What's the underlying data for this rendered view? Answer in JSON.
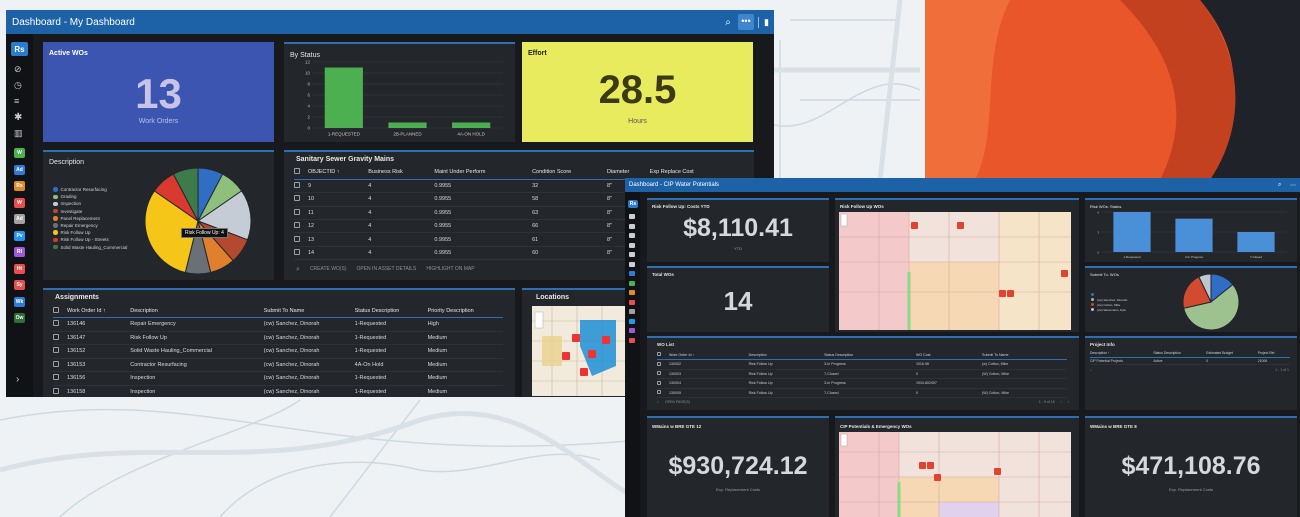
{
  "main_window": {
    "title": "Dashboard - My Dashboard",
    "sidebar_logo": "Rs",
    "sidebar_badges": [
      {
        "text": "W",
        "color": "#4caf50"
      },
      {
        "text": "Ad",
        "color": "#2f7bd8"
      },
      {
        "text": "Rs",
        "color": "#e08b2a"
      },
      {
        "text": "W",
        "color": "#e84e4e"
      },
      {
        "text": "Ad",
        "color": "#a0a0a0"
      },
      {
        "text": "Pv",
        "color": "#2196f3"
      },
      {
        "text": "Rl",
        "color": "#9c5ad7"
      },
      {
        "text": "Ht",
        "color": "#e84e4e"
      },
      {
        "text": "Sy",
        "color": "#e84e4e"
      },
      {
        "text": "Wk",
        "color": "#2f7bd8"
      },
      {
        "text": "Ow",
        "color": "#2f6f38"
      }
    ],
    "active_wos": {
      "title": "Active WOs",
      "value": "13",
      "label": "Work Orders"
    },
    "by_status": {
      "title": "By Status"
    },
    "effort": {
      "title": "Effort",
      "value": "28.5",
      "label": "Hours"
    },
    "description": {
      "title": "Description",
      "legend": [
        "Contractor Resurfacing",
        "Grading",
        "Inspection",
        "Investigate",
        "Panel Replacement",
        "Repair Emergency",
        "Risk Follow Up",
        "Risk Follow Up - Streets",
        "Solid Waste Hauling_Commercial"
      ],
      "tooltip": "Risk Follow Up: 4"
    },
    "sewer": {
      "title": "Sanitary Sewer Gravity Mains",
      "columns": [
        "OBJECTID ↑",
        "Business Risk",
        "Maint Under Perform",
        "Condition Score",
        "Diameter",
        "Exp Replace Cost"
      ],
      "rows": [
        [
          "9",
          "4",
          "0.9955",
          "32",
          "8\""
        ],
        [
          "10",
          "4",
          "0.9955",
          "58",
          "8\""
        ],
        [
          "11",
          "4",
          "0.9955",
          "63",
          "8\""
        ],
        [
          "12",
          "4",
          "0.9955",
          "66",
          "8\""
        ],
        [
          "13",
          "4",
          "0.9955",
          "61",
          "8\""
        ],
        [
          "14",
          "4",
          "0.9955",
          "60",
          "8\""
        ]
      ],
      "actions": [
        "CREATE WO(S)",
        "OPEN IN ASSET DETAILS",
        "HIGHLIGHT ON MAP"
      ]
    },
    "assignments": {
      "title": "Assignments",
      "columns": [
        "Work Order Id ↑",
        "Description",
        "Submit To Name",
        "Status Description",
        "Priority Description"
      ],
      "rows": [
        [
          "136146",
          "Repair Emergency",
          "(cw) Sanchez, Dinorah",
          "1-Requested",
          "High"
        ],
        [
          "136147",
          "Risk Follow Up",
          "(cw) Sanchez, Dinorah",
          "1-Requested",
          "Medium"
        ],
        [
          "136152",
          "Solid Waste Hauling_Commercial",
          "(cw) Sanchez, Dinorah",
          "1-Requested",
          "Medium"
        ],
        [
          "136153",
          "Contractor Resurfacing",
          "(cw) Sanchez, Dinorah",
          "4A-On Hold",
          "Medium"
        ],
        [
          "136156",
          "Inspection",
          "(cw) Sanchez, Dinorah",
          "1-Requested",
          "Medium"
        ],
        [
          "136158",
          "Inspection",
          "(cw) Sanchez, Dinorah",
          "1-Requested",
          "Medium"
        ]
      ]
    },
    "locations": {
      "title": "Locations"
    }
  },
  "second_window": {
    "title": "Dashboard - CIP Water Potentials",
    "sidebar_logo": "Rs",
    "risk_costs": {
      "title": "Risk Follow Up: Costs YTD",
      "value": "$8,110.41",
      "label": "YTD"
    },
    "risk_wos_map": {
      "title": "Risk Follow Up WOs"
    },
    "risk_wos_status": {
      "title": "Risk WOs: Status"
    },
    "total_wos": {
      "title": "Total WOs",
      "value": "14"
    },
    "submit_to": {
      "title": "Submit To: WOs",
      "legend": [
        "",
        "(cw) Sanchez, Dinorah",
        "(cw) Cotton, Mike",
        "(cw) Wessmann, Kyle"
      ]
    },
    "wo_list": {
      "title": "WO List",
      "columns": [
        "Work Order Id ↑",
        "Description",
        "Status Description",
        "WO Cost",
        "Submit To Name"
      ],
      "rows": [
        [
          "130002",
          "Risk Follow Up",
          "3-In Progress",
          "1016.98",
          "(w) Cotton, Mike"
        ],
        [
          "130003",
          "Risk Follow Up",
          "7-Closed",
          "0",
          "(W) Cotton, Mike"
        ],
        [
          "130004",
          "Risk Follow Up",
          "3-In Progress",
          "1934.802497",
          ""
        ],
        [
          "130005",
          "Risk Follow Up",
          "7-Closed",
          "0",
          "(W) Cotton, Mike"
        ]
      ],
      "action": "OPEN PAGE(S)",
      "pager": "1 - 5 of 15"
    },
    "project_info": {
      "title": "Project Info",
      "columns": [
        "Description ↑",
        "Status Description",
        "Estimated Budget",
        "Project Ret"
      ],
      "rows": [
        [
          "CIP Potential Projects",
          "Active",
          "0",
          "21006"
        ]
      ],
      "pager": "1 - 1 of 1"
    },
    "wmains_12": {
      "title": "WMains w BRE GTE 12",
      "value": "$930,724.12",
      "label": "Exp. Replacement Costs"
    },
    "cip_map": {
      "title": "CIP Potentials & Emergency WOs"
    },
    "wmains_8": {
      "title": "WMains w BRE GTE 8",
      "value": "$471,108.76",
      "label": "Exp. Replacement Costs"
    }
  },
  "chart_data": [
    {
      "type": "bar",
      "title": "By Status",
      "categories": [
        "1-REQUESTED",
        "2B-PLANNED",
        "4A-ON HOLD"
      ],
      "values": [
        11,
        1,
        1
      ],
      "ylim": [
        0,
        12
      ],
      "yticks": [
        0,
        2,
        4,
        6,
        8,
        10,
        12
      ],
      "color": "#4caf50"
    },
    {
      "type": "pie",
      "title": "Description",
      "categories": [
        "Contractor Resurfacing",
        "Grading",
        "Inspection",
        "Investigate",
        "Panel Replacement",
        "Repair Emergency",
        "Risk Follow Up",
        "Risk Follow Up - Streets",
        "Solid Waste Hauling_Commercial"
      ],
      "values": [
        1,
        1,
        2,
        1,
        1,
        1,
        4,
        1,
        1
      ],
      "colors": [
        "#2f6ec4",
        "#8ec07c",
        "#c5ccd6",
        "#b5492f",
        "#e07f2c",
        "#6b7078",
        "#f5c518",
        "#d93a2f",
        "#3d7c4a"
      ]
    },
    {
      "type": "bar",
      "title": "Risk WOs: Status",
      "categories": [
        "1-Requested",
        "3-In Progress",
        "7-Closed"
      ],
      "values": [
        6,
        5,
        3
      ],
      "ylim": [
        0,
        6
      ],
      "color": "#4a90d9"
    },
    {
      "type": "pie",
      "title": "Submit To: WOs",
      "categories": [
        "",
        "(cw) Sanchez, Dinorah",
        "(cw) Cotton, Mike",
        "(cw) Wessmann, Kyle"
      ],
      "values": [
        2,
        8,
        3,
        1
      ],
      "colors": [
        "#2f6ec4",
        "#9ec28f",
        "#d24a2f",
        "#c0c6cf"
      ]
    }
  ]
}
